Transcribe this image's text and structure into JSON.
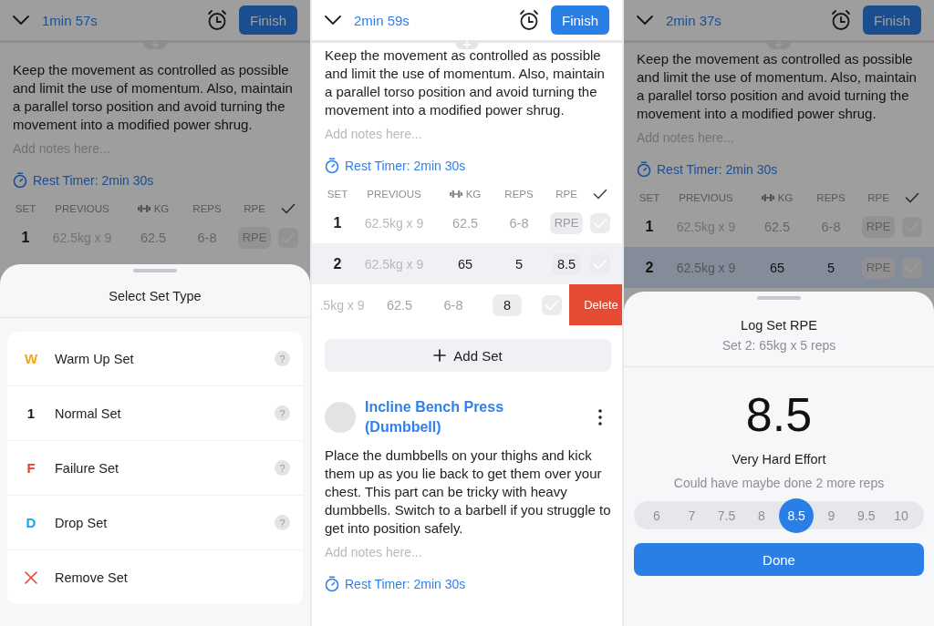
{
  "panels": [
    {
      "dimmed": true,
      "header": {
        "duration": "1min 57s",
        "finish": "Finish"
      },
      "exercises": [
        {
          "description": "Keep the movement as controlled as possible and limit the use of momentum. Also, maintain a parallel torso position and avoid turning the movement into a modified power shrug.",
          "placeholder": "Add notes here...",
          "rest_timer": "Rest Timer: 2min 30s",
          "columns": [
            {
              "label": "SET"
            },
            {
              "label": "PREVIOUS"
            },
            {
              "label": "KG",
              "kind": "weight"
            },
            {
              "label": "REPS"
            },
            {
              "label": "RPE"
            },
            {
              "kind": "done"
            }
          ],
          "sets": [
            {
              "set": "1",
              "previous": "62.5kg x 9",
              "kg": "62.5",
              "reps": "6-8",
              "rpe_placeholder": "RPE",
              "entered": false,
              "completed": false
            }
          ]
        }
      ],
      "sheet": {
        "kind": "set_type",
        "title": "Select Set Type",
        "options": [
          {
            "kind": "type",
            "badge": "W",
            "color": "#f2a51c",
            "label": "Warm Up Set",
            "help": "?"
          },
          {
            "kind": "type",
            "badge": "1",
            "color": "#1c1c1e",
            "label": "Normal Set",
            "help": "?"
          },
          {
            "kind": "type",
            "badge": "F",
            "color": "#e8402f",
            "label": "Failure Set",
            "help": "?"
          },
          {
            "kind": "type",
            "badge": "D",
            "color": "#1aa3ee",
            "label": "Drop Set",
            "help": "?"
          },
          {
            "kind": "remove",
            "label": "Remove Set"
          }
        ]
      }
    },
    {
      "dimmed": false,
      "header": {
        "duration": "2min 59s",
        "finish": "Finish"
      },
      "exercises": [
        {
          "description": "Keep the movement as controlled as possible and limit the use of momentum. Also, maintain a parallel torso position and avoid turning the movement into a modified power shrug.",
          "placeholder": "Add notes here...",
          "rest_timer": "Rest Timer: 2min 30s",
          "columns": [
            {
              "label": "SET"
            },
            {
              "label": "PREVIOUS"
            },
            {
              "label": "KG",
              "kind": "weight"
            },
            {
              "label": "REPS"
            },
            {
              "label": "RPE"
            },
            {
              "kind": "done"
            }
          ],
          "sets": [
            {
              "set": "1",
              "previous": "62.5kg x 9",
              "kg": "62.5",
              "reps": "6-8",
              "rpe_placeholder": "RPE",
              "entered": false,
              "completed": false
            },
            {
              "set": "2",
              "previous": "62.5kg x 9",
              "kg": "65",
              "reps": "5",
              "rpe": "8.5",
              "entered": true,
              "completed": false,
              "pressed": true
            },
            {
              "swiped": true,
              "previous": ".5kg x 9",
              "kg": "62.5",
              "reps": "6-8",
              "rpe": "8",
              "entered": false,
              "completed": false,
              "delete": "Delete"
            }
          ],
          "add_set": "Add Set"
        },
        {
          "title": "Incline Bench Press (Dumbbell)",
          "description": "Place the dumbbells on your thighs and kick them up as you lie back to get them over your chest. This part can be tricky with heavy dumbbells. Switch to a barbell if you struggle to get into position safely.",
          "placeholder": "Add notes here...",
          "rest_timer": "Rest Timer: 2min 30s"
        }
      ]
    },
    {
      "dimmed": true,
      "header": {
        "duration": "2min 37s",
        "finish": "Finish"
      },
      "exercises": [
        {
          "description": "Keep the movement as controlled as possible and limit the use of momentum. Also, maintain a parallel torso position and avoid turning the movement into a modified power shrug.",
          "placeholder": "Add notes here...",
          "rest_timer": "Rest Timer: 2min 30s",
          "columns": [
            {
              "label": "SET"
            },
            {
              "label": "PREVIOUS"
            },
            {
              "label": "KG",
              "kind": "weight"
            },
            {
              "label": "REPS"
            },
            {
              "label": "RPE"
            },
            {
              "kind": "done"
            }
          ],
          "sets": [
            {
              "set": "1",
              "previous": "62.5kg x 9",
              "kg": "62.5",
              "reps": "6-8",
              "rpe_placeholder": "RPE",
              "entered": false,
              "completed": false
            },
            {
              "set": "2",
              "previous": "62.5kg x 9",
              "kg": "65",
              "reps": "5",
              "rpe_placeholder": "RPE",
              "entered": true,
              "completed": false,
              "editing": true
            }
          ]
        }
      ],
      "sheet": {
        "kind": "rpe",
        "title": "Log Set RPE",
        "subtitle": "Set 2: 65kg x 5 reps",
        "value": "8.5",
        "effort": "Very Hard Effort",
        "detail": "Could have maybe done 2 more reps",
        "options": [
          {
            "label": "6",
            "selected": false
          },
          {
            "label": "7",
            "selected": false
          },
          {
            "label": "7.5",
            "selected": false
          },
          {
            "label": "8",
            "selected": false
          },
          {
            "label": "8.5",
            "selected": true
          },
          {
            "label": "9",
            "selected": false
          },
          {
            "label": "9.5",
            "selected": false
          },
          {
            "label": "10",
            "selected": false
          }
        ],
        "button": "Done"
      }
    }
  ]
}
